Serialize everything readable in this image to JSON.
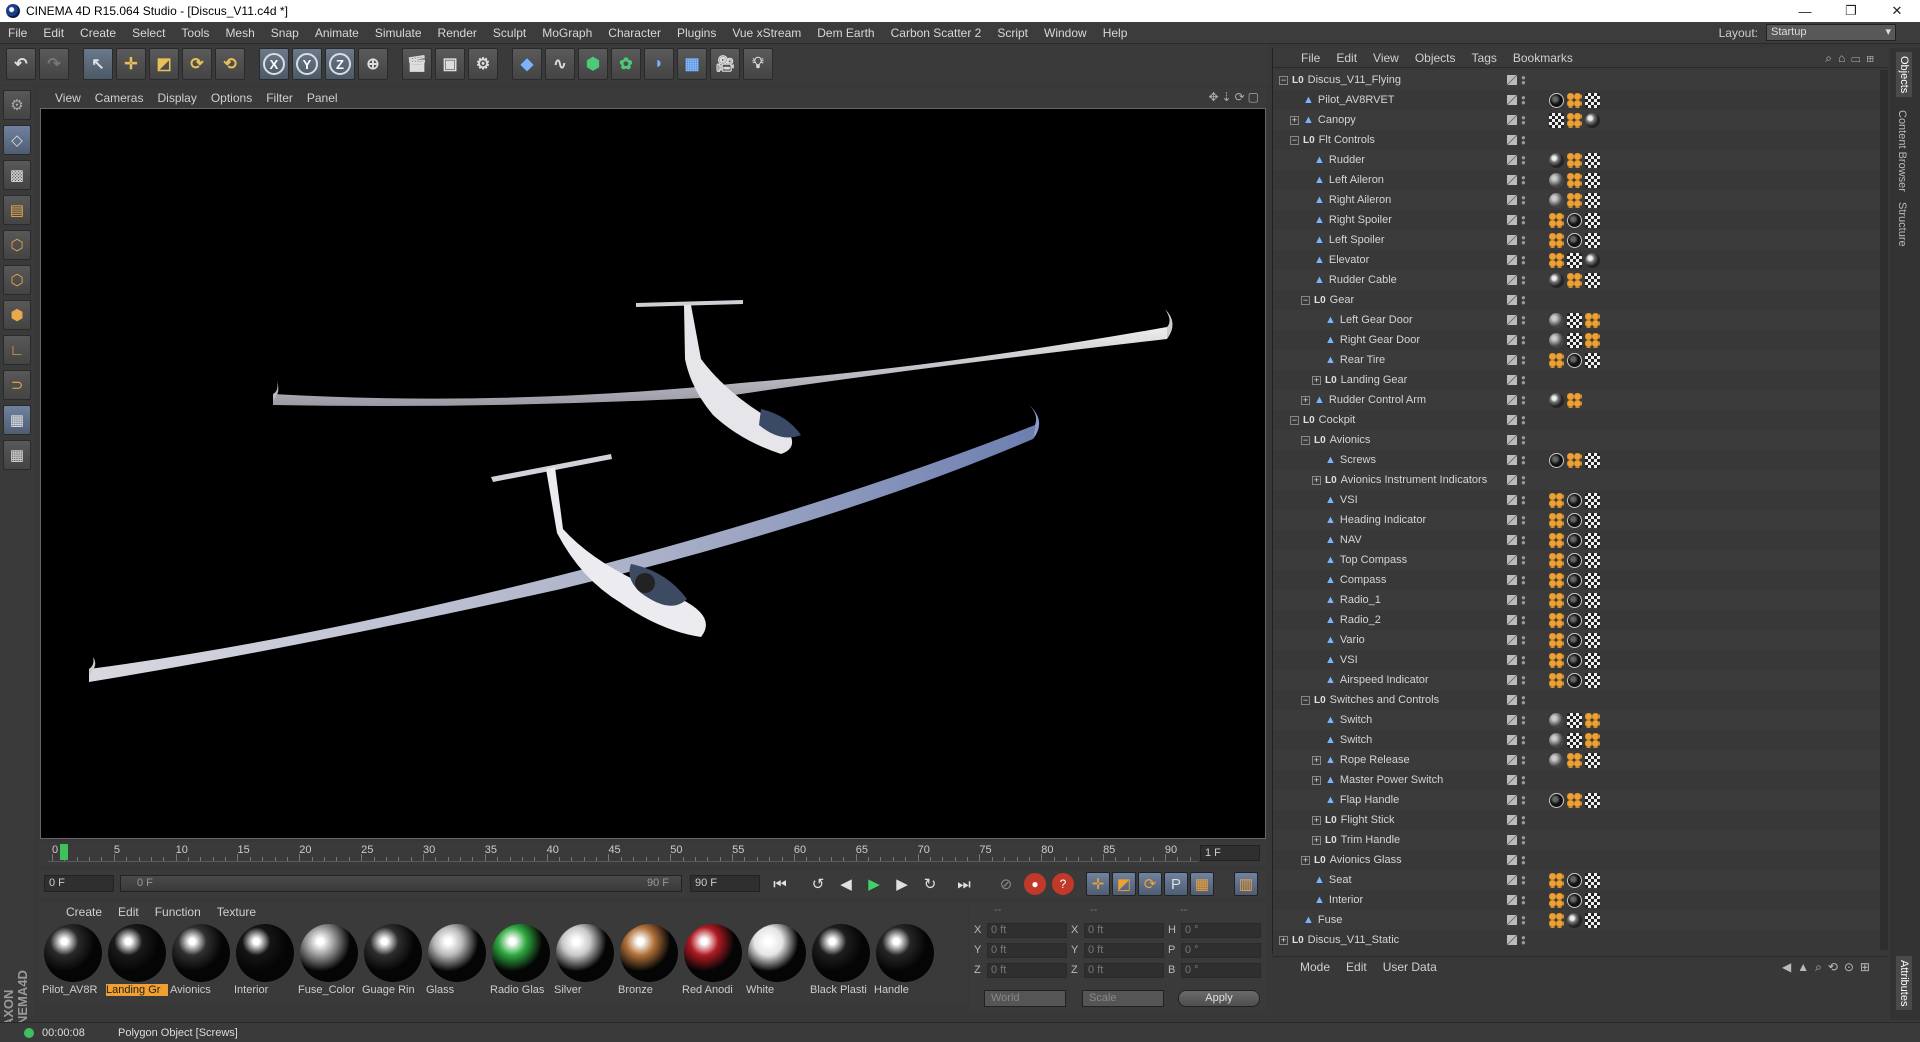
{
  "window": {
    "title": "CINEMA 4D R15.064 Studio - [Discus_V11.c4d *]",
    "controls": [
      "—",
      "❐",
      "✕"
    ]
  },
  "menubar": {
    "items": [
      "File",
      "Edit",
      "Create",
      "Select",
      "Tools",
      "Mesh",
      "Snap",
      "Animate",
      "Simulate",
      "Render",
      "Sculpt",
      "MoGraph",
      "Character",
      "Plugins",
      "Vue xStream",
      "Dem Earth",
      "Carbon Scatter 2",
      "Script",
      "Window",
      "Help"
    ],
    "layout_label": "Layout:",
    "layout_value": "Startup"
  },
  "viewport": {
    "menu": [
      "View",
      "Cameras",
      "Display",
      "Options",
      "Filter",
      "Panel"
    ]
  },
  "timeline": {
    "ticks": [
      "0",
      "5",
      "10",
      "15",
      "20",
      "25",
      "30",
      "35",
      "40",
      "45",
      "50",
      "55",
      "60",
      "65",
      "70",
      "75",
      "80",
      "85",
      "90"
    ],
    "current_frame": "1 F"
  },
  "transport": {
    "start": "0 F",
    "range_start": "0 F",
    "range_end": "90 F",
    "end": "90 F"
  },
  "material_manager": {
    "menu": [
      "Create",
      "Edit",
      "Function",
      "Texture"
    ],
    "materials": [
      {
        "label": "Pilot_AV8R",
        "selected": false,
        "color": "#2a2a2a"
      },
      {
        "label": "Landing Gr",
        "selected": true,
        "color": "#1a1a1a"
      },
      {
        "label": "Avionics",
        "selected": false,
        "color": "#303030"
      },
      {
        "label": "Interior",
        "selected": false,
        "color": "#151515"
      },
      {
        "label": "Fuse_Color",
        "selected": false,
        "color": "#9a9a9a"
      },
      {
        "label": "Guage Rin",
        "selected": false,
        "color": "#2e2e2e"
      },
      {
        "label": "Glass",
        "selected": false,
        "color": "#b8b8b8"
      },
      {
        "label": "Radio Glas",
        "selected": false,
        "color": "#2fa83f"
      },
      {
        "label": "Silver",
        "selected": false,
        "color": "#c8c8c8"
      },
      {
        "label": "Bronze",
        "selected": false,
        "color": "#b0713a"
      },
      {
        "label": "Red Anodi",
        "selected": false,
        "color": "#b01a22"
      },
      {
        "label": "White",
        "selected": false,
        "color": "#e4e4e4"
      },
      {
        "label": "Black Plasti",
        "selected": false,
        "color": "#1e1e1e"
      },
      {
        "label": "Handle",
        "selected": false,
        "color": "#262626"
      }
    ]
  },
  "coordinates": {
    "headers": [
      "--",
      "--",
      "--"
    ],
    "rows": [
      [
        {
          "axis": "X",
          "value": "0 ft"
        },
        {
          "axis": "X",
          "value": "0 ft"
        },
        {
          "axis": "H",
          "value": "0 °"
        }
      ],
      [
        {
          "axis": "Y",
          "value": "0 ft"
        },
        {
          "axis": "Y",
          "value": "0 ft"
        },
        {
          "axis": "P",
          "value": "0 °"
        }
      ],
      [
        {
          "axis": "Z",
          "value": "0 ft"
        },
        {
          "axis": "Z",
          "value": "0 ft"
        },
        {
          "axis": "B",
          "value": "0 °"
        }
      ]
    ],
    "space": "World",
    "mode": "Scale",
    "apply_label": "Apply"
  },
  "statusbar": {
    "time": "00:00:08",
    "message": "Polygon Object [Screws]"
  },
  "object_manager": {
    "menu": [
      "File",
      "Edit",
      "View",
      "Objects",
      "Tags",
      "Bookmarks"
    ],
    "objects": [
      {
        "name": "Discus_V11_Flying",
        "indent": 0,
        "type": "null",
        "exp": "−",
        "tags": []
      },
      {
        "name": "Pilot_AV8RVET",
        "indent": 1,
        "type": "poly",
        "exp": "",
        "tags": [
          "bk",
          "or",
          "ck"
        ]
      },
      {
        "name": "Canopy",
        "indent": 1,
        "type": "poly",
        "exp": "+",
        "tags": [
          "ck",
          "or",
          "ph"
        ]
      },
      {
        "name": "Flt Controls",
        "indent": 1,
        "type": "null",
        "exp": "−",
        "tags": []
      },
      {
        "name": "Rudder",
        "indent": 2,
        "type": "poly",
        "exp": "",
        "tags": [
          "ph",
          "or",
          "ck"
        ]
      },
      {
        "name": "Left Aileron",
        "indent": 2,
        "type": "poly",
        "exp": "",
        "tags": [
          "tx",
          "or",
          "ck"
        ]
      },
      {
        "name": "Right Aileron",
        "indent": 2,
        "type": "poly",
        "exp": "",
        "tags": [
          "tx",
          "or",
          "ck"
        ]
      },
      {
        "name": "Right Spoiler",
        "indent": 2,
        "type": "poly",
        "exp": "",
        "tags": [
          "or",
          "bk",
          "ck"
        ]
      },
      {
        "name": "Left Spoiler",
        "indent": 2,
        "type": "poly",
        "exp": "",
        "tags": [
          "or",
          "bk",
          "ck"
        ]
      },
      {
        "name": "Elevator",
        "indent": 2,
        "type": "poly",
        "exp": "",
        "tags": [
          "or",
          "ck",
          "ph"
        ]
      },
      {
        "name": "Rudder Cable",
        "indent": 2,
        "type": "poly",
        "exp": "",
        "tags": [
          "ph",
          "or",
          "ck"
        ]
      },
      {
        "name": "Gear",
        "indent": 2,
        "type": "null",
        "exp": "−",
        "tags": []
      },
      {
        "name": "Left Gear Door",
        "indent": 3,
        "type": "poly",
        "exp": "",
        "tags": [
          "tx",
          "ck",
          "or"
        ]
      },
      {
        "name": "Right Gear Door",
        "indent": 3,
        "type": "poly",
        "exp": "",
        "tags": [
          "tx",
          "ck",
          "or"
        ]
      },
      {
        "name": "Rear Tire",
        "indent": 3,
        "type": "poly",
        "exp": "",
        "tags": [
          "or",
          "bk",
          "ck"
        ]
      },
      {
        "name": "Landing Gear",
        "indent": 3,
        "type": "null",
        "exp": "+",
        "tags": []
      },
      {
        "name": "Rudder Control Arm",
        "indent": 2,
        "type": "poly",
        "exp": "+",
        "tags": [
          "ph",
          "or"
        ]
      },
      {
        "name": "Cockpit",
        "indent": 1,
        "type": "null",
        "exp": "−",
        "tags": []
      },
      {
        "name": "Avionics",
        "indent": 2,
        "type": "null",
        "exp": "−",
        "tags": []
      },
      {
        "name": "Screws",
        "indent": 3,
        "type": "poly",
        "exp": "",
        "tags": [
          "bk",
          "or",
          "ck"
        ]
      },
      {
        "name": "Avionics Instrument Indicators",
        "indent": 3,
        "type": "null",
        "exp": "+",
        "tags": []
      },
      {
        "name": "VSI",
        "indent": 3,
        "type": "poly",
        "exp": "",
        "tags": [
          "or",
          "bk",
          "ck"
        ]
      },
      {
        "name": "Heading Indicator",
        "indent": 3,
        "type": "poly",
        "exp": "",
        "tags": [
          "or",
          "bk",
          "ck"
        ]
      },
      {
        "name": "NAV",
        "indent": 3,
        "type": "poly",
        "exp": "",
        "tags": [
          "or",
          "bk",
          "ck"
        ]
      },
      {
        "name": "Top Compass",
        "indent": 3,
        "type": "poly",
        "exp": "",
        "tags": [
          "or",
          "bk",
          "ck"
        ]
      },
      {
        "name": "Compass",
        "indent": 3,
        "type": "poly",
        "exp": "",
        "tags": [
          "or",
          "bk",
          "ck"
        ]
      },
      {
        "name": "Radio_1",
        "indent": 3,
        "type": "poly",
        "exp": "",
        "tags": [
          "or",
          "bk",
          "ck"
        ]
      },
      {
        "name": "Radio_2",
        "indent": 3,
        "type": "poly",
        "exp": "",
        "tags": [
          "or",
          "bk",
          "ck"
        ]
      },
      {
        "name": "Vario",
        "indent": 3,
        "type": "poly",
        "exp": "",
        "tags": [
          "or",
          "bk",
          "ck"
        ]
      },
      {
        "name": "VSI",
        "indent": 3,
        "type": "poly",
        "exp": "",
        "tags": [
          "or",
          "bk",
          "ck"
        ]
      },
      {
        "name": "Airspeed Indicator",
        "indent": 3,
        "type": "poly",
        "exp": "",
        "tags": [
          "or",
          "bk",
          "ck"
        ]
      },
      {
        "name": "Switches and Controls",
        "indent": 2,
        "type": "null",
        "exp": "−",
        "tags": []
      },
      {
        "name": "Switch",
        "indent": 3,
        "type": "poly",
        "exp": "",
        "tags": [
          "tx",
          "ck",
          "or"
        ]
      },
      {
        "name": "Switch",
        "indent": 3,
        "type": "poly",
        "exp": "",
        "tags": [
          "tx",
          "ck",
          "or"
        ]
      },
      {
        "name": "Rope Release",
        "indent": 3,
        "type": "poly",
        "exp": "+",
        "tags": [
          "tx",
          "or",
          "ck"
        ]
      },
      {
        "name": "Master Power Switch",
        "indent": 3,
        "type": "poly",
        "exp": "+",
        "tags": []
      },
      {
        "name": "Flap Handle",
        "indent": 3,
        "type": "poly",
        "exp": "",
        "tags": [
          "bk",
          "or",
          "ck"
        ]
      },
      {
        "name": "Flight Stick",
        "indent": 3,
        "type": "null",
        "exp": "+",
        "tags": []
      },
      {
        "name": "Trim Handle",
        "indent": 3,
        "type": "null",
        "exp": "+",
        "tags": []
      },
      {
        "name": "Avionics Glass",
        "indent": 2,
        "type": "null",
        "exp": "+",
        "tags": []
      },
      {
        "name": "Seat",
        "indent": 2,
        "type": "poly",
        "exp": "",
        "tags": [
          "or",
          "bk",
          "ck"
        ]
      },
      {
        "name": "Interior",
        "indent": 2,
        "type": "poly",
        "exp": "",
        "tags": [
          "or",
          "bk",
          "ck"
        ]
      },
      {
        "name": "Fuse",
        "indent": 1,
        "type": "poly",
        "exp": "",
        "tags": [
          "or",
          "ph",
          "ck"
        ]
      },
      {
        "name": "Discus_V11_Static",
        "indent": 0,
        "type": "null",
        "exp": "+",
        "tags": []
      }
    ]
  },
  "attributes": {
    "menu": [
      "Mode",
      "Edit",
      "User Data"
    ]
  },
  "side_tabs": [
    "Objects",
    "Content Browser",
    "Structure",
    "Attributes"
  ]
}
